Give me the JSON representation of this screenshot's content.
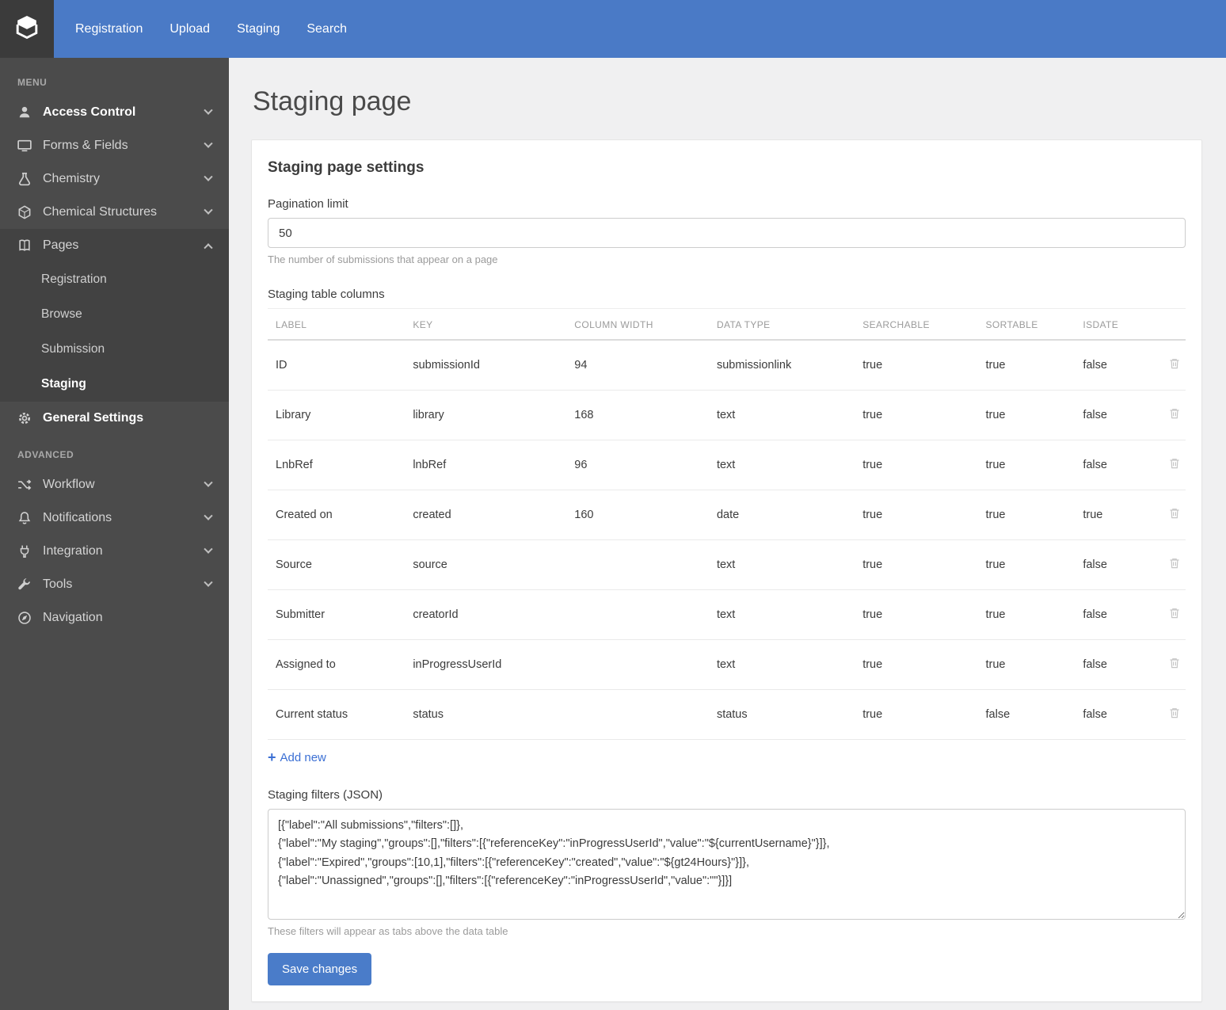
{
  "accent": "#4a7bc8",
  "topnav": {
    "items": [
      {
        "label": "Registration"
      },
      {
        "label": "Upload"
      },
      {
        "label": "Staging"
      },
      {
        "label": "Search"
      }
    ]
  },
  "sidebar": {
    "sections": [
      {
        "header": "MENU",
        "items": [
          {
            "label": "Access Control",
            "icon": "user-icon",
            "chevron": "down",
            "bold": true
          },
          {
            "label": "Forms & Fields",
            "icon": "monitor-icon",
            "chevron": "down"
          },
          {
            "label": "Chemistry",
            "icon": "flask-icon",
            "chevron": "down"
          },
          {
            "label": "Chemical Structures",
            "icon": "cube-icon",
            "chevron": "down"
          },
          {
            "label": "Pages",
            "icon": "book-icon",
            "chevron": "up",
            "expanded": true,
            "subitems": [
              {
                "label": "Registration"
              },
              {
                "label": "Browse"
              },
              {
                "label": "Submission"
              },
              {
                "label": "Staging",
                "active": true
              }
            ]
          },
          {
            "label": "General Settings",
            "icon": "gear-icon",
            "bold": true
          }
        ]
      },
      {
        "header": "ADVANCED",
        "items": [
          {
            "label": "Workflow",
            "icon": "shuffle-icon",
            "chevron": "down"
          },
          {
            "label": "Notifications",
            "icon": "bell-icon",
            "chevron": "down"
          },
          {
            "label": "Integration",
            "icon": "plug-icon",
            "chevron": "down"
          },
          {
            "label": "Tools",
            "icon": "wrench-icon",
            "chevron": "down"
          },
          {
            "label": "Navigation",
            "icon": "compass-icon"
          }
        ]
      }
    ]
  },
  "main": {
    "page_title": "Staging page",
    "settings_card": {
      "title": "Staging page settings",
      "pagination_limit": {
        "label": "Pagination limit",
        "value": "50",
        "help": "The number of submissions that appear on a page"
      },
      "columns_table": {
        "label": "Staging table columns",
        "headers": [
          "LABEL",
          "KEY",
          "COLUMN WIDTH",
          "DATA TYPE",
          "SEARCHABLE",
          "SORTABLE",
          "ISDATE"
        ],
        "rows": [
          {
            "cells": [
              "ID",
              "submissionId",
              "94",
              "submissionlink",
              "true",
              "true",
              "false"
            ]
          },
          {
            "cells": [
              "Library",
              "library",
              "168",
              "text",
              "true",
              "true",
              "false"
            ]
          },
          {
            "cells": [
              "LnbRef",
              "lnbRef",
              "96",
              "text",
              "true",
              "true",
              "false"
            ]
          },
          {
            "cells": [
              "Created on",
              "created",
              "160",
              "date",
              "true",
              "true",
              "true"
            ]
          },
          {
            "cells": [
              "Source",
              "source",
              "",
              "text",
              "true",
              "true",
              "false"
            ]
          },
          {
            "cells": [
              "Submitter",
              "creatorId",
              "",
              "text",
              "true",
              "true",
              "false"
            ]
          },
          {
            "cells": [
              "Assigned to",
              "inProgressUserId",
              "",
              "text",
              "true",
              "true",
              "false"
            ]
          },
          {
            "cells": [
              "Current status",
              "status",
              "",
              "status",
              "true",
              "false",
              "false"
            ]
          }
        ],
        "add_new_label": "Add new"
      },
      "filters": {
        "label": "Staging filters (JSON)",
        "value": "[{\"label\":\"All submissions\",\"filters\":[]},\n{\"label\":\"My staging\",\"groups\":[],\"filters\":[{\"referenceKey\":\"inProgressUserId\",\"value\":\"${currentUsername}\"}]},\n{\"label\":\"Expired\",\"groups\":[10,1],\"filters\":[{\"referenceKey\":\"created\",\"value\":\"${gt24Hours}\"}]},\n{\"label\":\"Unassigned\",\"groups\":[],\"filters\":[{\"referenceKey\":\"inProgressUserId\",\"value\":\"\"}]}]",
        "help": "These filters will appear as tabs above the data table"
      },
      "save_button_label": "Save changes"
    }
  }
}
